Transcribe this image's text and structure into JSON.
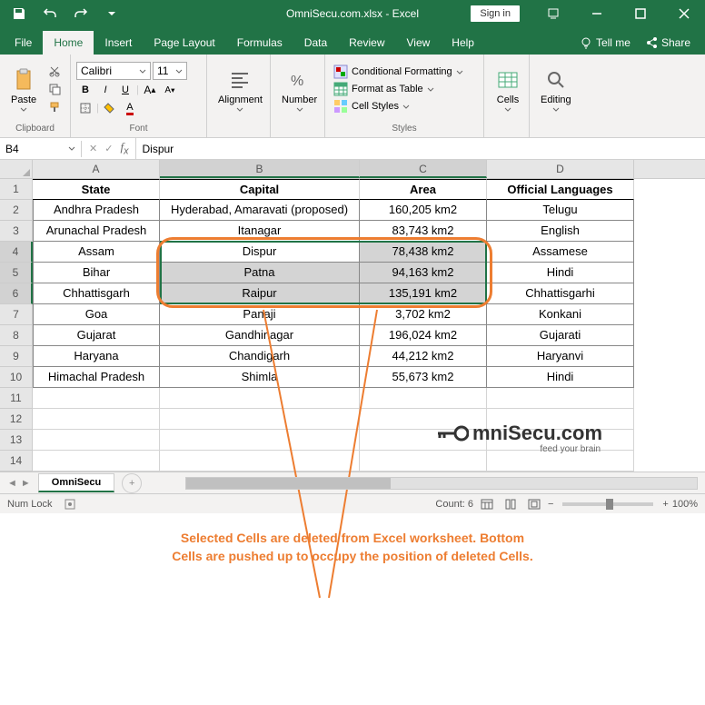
{
  "title": "OmniSecu.com.xlsx - Excel",
  "signin": "Sign in",
  "tabs": {
    "file": "File",
    "home": "Home",
    "insert": "Insert",
    "page_layout": "Page Layout",
    "formulas": "Formulas",
    "data": "Data",
    "review": "Review",
    "view": "View",
    "help": "Help",
    "tellme": "Tell me",
    "share": "Share"
  },
  "ribbon": {
    "clipboard": {
      "label": "Clipboard",
      "paste": "Paste"
    },
    "font": {
      "label": "Font",
      "name": "Calibri",
      "size": "11"
    },
    "alignment": {
      "label": "Alignment"
    },
    "number": {
      "label": "Number"
    },
    "styles": {
      "label": "Styles",
      "cond": "Conditional Formatting",
      "table": "Format as Table",
      "cell": "Cell Styles"
    },
    "cells": {
      "label": "Cells"
    },
    "editing": {
      "label": "Editing"
    }
  },
  "namebox": "B4",
  "formula": "Dispur",
  "columns": [
    "A",
    "B",
    "C",
    "D"
  ],
  "rows": [
    "1",
    "2",
    "3",
    "4",
    "5",
    "6",
    "7",
    "8",
    "9",
    "10",
    "11",
    "12",
    "13",
    "14"
  ],
  "headers": {
    "state": "State",
    "capital": "Capital",
    "area": "Area",
    "lang": "Official Languages"
  },
  "data": [
    {
      "state": "Andhra Pradesh",
      "capital": "Hyderabad, Amaravati (proposed)",
      "area": "160,205 km2",
      "lang": "Telugu"
    },
    {
      "state": "Arunachal Pradesh",
      "capital": "Itanagar",
      "area": "83,743 km2",
      "lang": "English"
    },
    {
      "state": "Assam",
      "capital": "Dispur",
      "area": "78,438 km2",
      "lang": "Assamese"
    },
    {
      "state": "Bihar",
      "capital": "Patna",
      "area": "94,163 km2",
      "lang": "Hindi"
    },
    {
      "state": "Chhattisgarh",
      "capital": "Raipur",
      "area": "135,191 km2",
      "lang": "Chhattisgarhi"
    },
    {
      "state": "Goa",
      "capital": "Panaji",
      "area": "3,702 km2",
      "lang": "Konkani"
    },
    {
      "state": "Gujarat",
      "capital": "Gandhinagar",
      "area": "196,024 km2",
      "lang": "Gujarati"
    },
    {
      "state": "Haryana",
      "capital": "Chandigarh",
      "area": "44,212 km2",
      "lang": "Haryanvi"
    },
    {
      "state": "Himachal Pradesh",
      "capital": "Shimla",
      "area": "55,673 km2",
      "lang": "Hindi"
    }
  ],
  "sheet": {
    "name": "OmniSecu"
  },
  "status": {
    "numlock": "Num Lock",
    "count": "Count: 6",
    "zoom": "100%"
  },
  "annotation": "Selected Cells are deleted from Excel worksheet. Bottom Cells are pushed up to occupy the position of deleted Cells.",
  "logo": {
    "brand": "mniSecu.com",
    "tagline": "feed your brain"
  }
}
